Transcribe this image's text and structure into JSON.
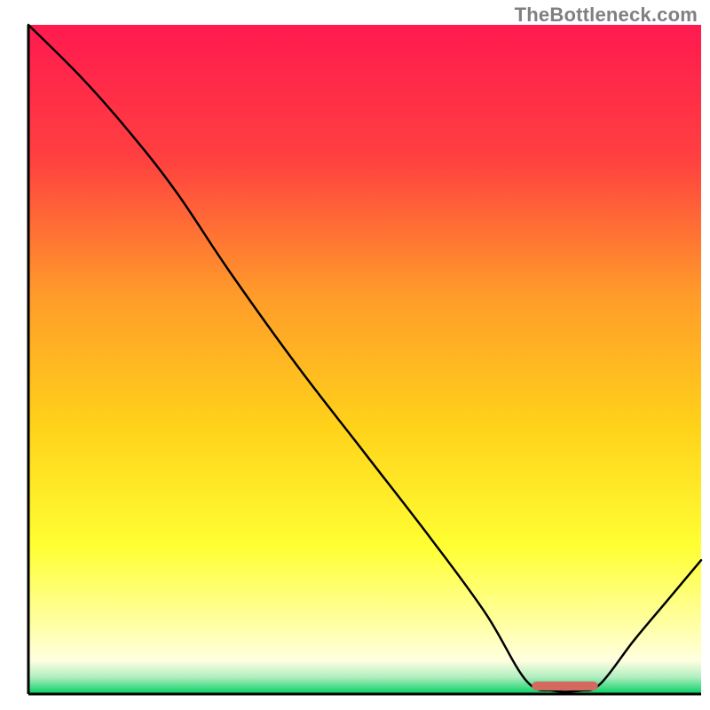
{
  "watermark": "TheBottleneck.com",
  "chart_data": {
    "type": "line",
    "title": "",
    "xlabel": "",
    "ylabel": "",
    "xlim": [
      0,
      100
    ],
    "ylim": [
      0,
      100
    ],
    "axes_visible": false,
    "grid": false,
    "background_gradient": {
      "stops": [
        {
          "offset": 0.0,
          "color": "#ff1a4f"
        },
        {
          "offset": 0.2,
          "color": "#ff4040"
        },
        {
          "offset": 0.4,
          "color": "#ff9a2a"
        },
        {
          "offset": 0.6,
          "color": "#ffd21a"
        },
        {
          "offset": 0.78,
          "color": "#ffff33"
        },
        {
          "offset": 0.9,
          "color": "#ffffa8"
        },
        {
          "offset": 0.95,
          "color": "#ffffe0"
        },
        {
          "offset": 0.975,
          "color": "#b0eec0"
        },
        {
          "offset": 1.0,
          "color": "#00d060"
        }
      ]
    },
    "curve": {
      "description": "Black bottleneck curve. Starts at 100 at x=0, drops steeply with a slight knee around x≈22 y≈75, falls nearly linearly to a flat minimum ≈0 between x≈74 and x≈85, then rises again to ≈20 at x=100.",
      "color": "#000000",
      "x": [
        0,
        8,
        15,
        22,
        30,
        40,
        50,
        60,
        68,
        74,
        78,
        82,
        85,
        90,
        95,
        100
      ],
      "y": [
        100,
        92,
        84,
        75,
        63,
        49,
        36,
        23,
        12,
        2,
        0.5,
        0.5,
        1.5,
        8,
        14,
        20
      ]
    },
    "flat_marker": {
      "description": "Short thick salmon-red segment highlighting the flat minimum of the curve.",
      "color": "#d46a5f",
      "x_start": 75.5,
      "x_end": 84,
      "y": 1.2,
      "thickness_pct": 1.35
    }
  }
}
